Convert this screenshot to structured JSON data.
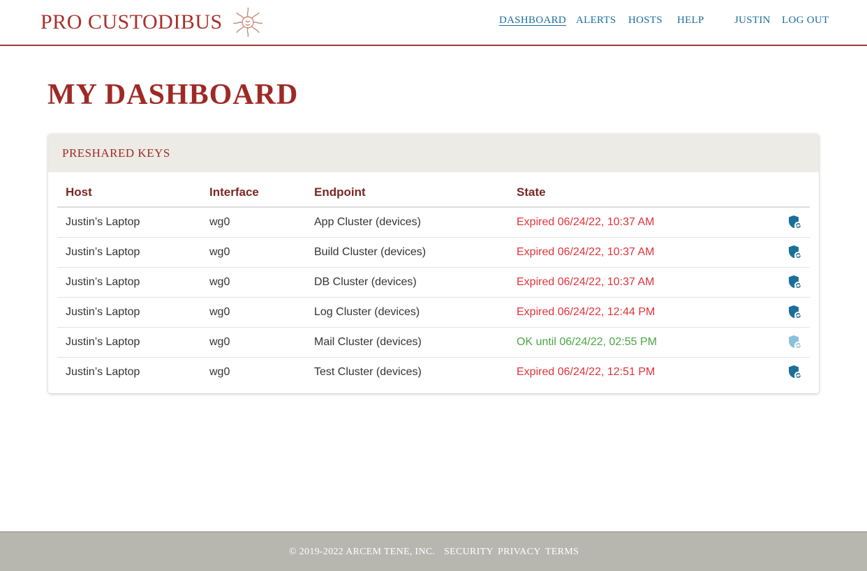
{
  "header": {
    "brand": "PRO CUSTODIBUS",
    "nav": {
      "dashboard": "DASHBOARD",
      "alerts": "ALERTS",
      "hosts": "HOSTS",
      "help": "HELP",
      "user": "JUSTIN",
      "logout": "LOG OUT"
    }
  },
  "page": {
    "title": "MY DASHBOARD"
  },
  "card": {
    "title": "PRESHARED KEYS",
    "columns": [
      "Host",
      "Interface",
      "Endpoint",
      "State"
    ],
    "rows": [
      {
        "host": "Justin’s Laptop",
        "interface": "wg0",
        "endpoint": "App Cluster (devices)",
        "state": "Expired 06/24/22, 10:37 AM",
        "status": "expired"
      },
      {
        "host": "Justin’s Laptop",
        "interface": "wg0",
        "endpoint": "Build Cluster (devices)",
        "state": "Expired 06/24/22, 10:37 AM",
        "status": "expired"
      },
      {
        "host": "Justin’s Laptop",
        "interface": "wg0",
        "endpoint": "DB Cluster (devices)",
        "state": "Expired 06/24/22, 10:37 AM",
        "status": "expired"
      },
      {
        "host": "Justin’s Laptop",
        "interface": "wg0",
        "endpoint": "Log Cluster (devices)",
        "state": "Expired 06/24/22, 12:44 PM",
        "status": "expired"
      },
      {
        "host": "Justin’s Laptop",
        "interface": "wg0",
        "endpoint": "Mail Cluster (devices)",
        "state": "OK until 06/24/22, 02:55 PM",
        "status": "ok"
      },
      {
        "host": "Justin’s Laptop",
        "interface": "wg0",
        "endpoint": "Test Cluster (devices)",
        "state": "Expired 06/24/22, 12:51 PM",
        "status": "expired"
      }
    ],
    "action_icon": "shield-rotate-icon"
  },
  "footer": {
    "copyright": "© 2019-2022 ARCEM TENE, INC.",
    "security": "SECURITY",
    "privacy": "PRIVACY",
    "terms": "TERMS"
  },
  "colors": {
    "brand": "#a8302b",
    "link": "#1c6e9b",
    "expired": "#e0333a",
    "ok": "#4aa544",
    "icon": "#1c6e9b",
    "icon_muted": "#8cc0dc"
  }
}
